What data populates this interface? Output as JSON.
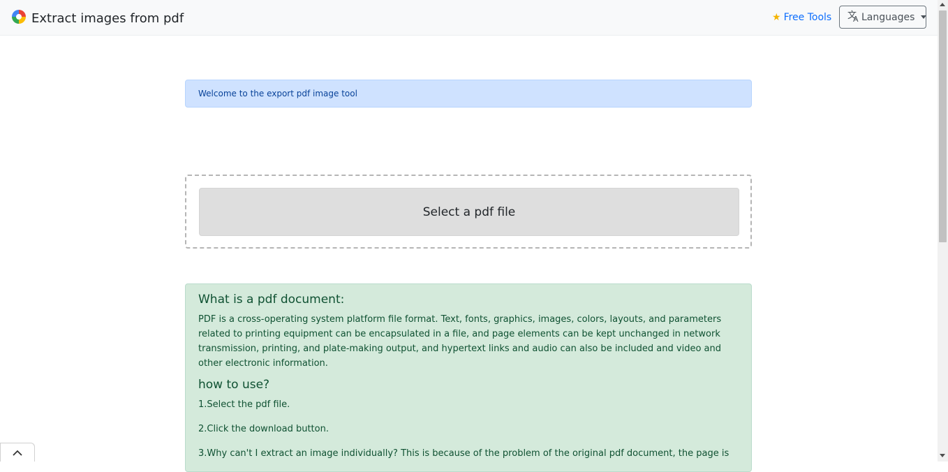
{
  "header": {
    "title": "Extract images from pdf",
    "free_tools_label": "Free Tools",
    "languages_label": "Languages"
  },
  "alert": {
    "text": "Welcome to the export pdf image tool"
  },
  "upload": {
    "select_label": "Select a pdf file"
  },
  "info": {
    "heading1": "What is a pdf document:",
    "description": "PDF is a cross-operating system platform file format. Text, fonts, graphics, images, colors, layouts, and parameters related to printing equipment can be encapsulated in a file, and page elements can be kept unchanged in network transmission, printing, and plate-making output, and hypertext links and audio can also be included and video and other electronic information.",
    "heading2": "how to use?",
    "steps": [
      "1.Select the pdf file.",
      "2.Click the download button.",
      "3.Why can't I extract an image individually? This is because of the problem of the original pdf document, the page is"
    ]
  },
  "colors": {
    "accent": "#0d6efd",
    "alert_bg": "#cfe2ff",
    "info_bg": "#d4eadb",
    "star": "#f4b400"
  },
  "icons": [
    "logo-icon",
    "star-icon",
    "translate-icon",
    "chevron-down-icon",
    "chevron-up-icon"
  ]
}
